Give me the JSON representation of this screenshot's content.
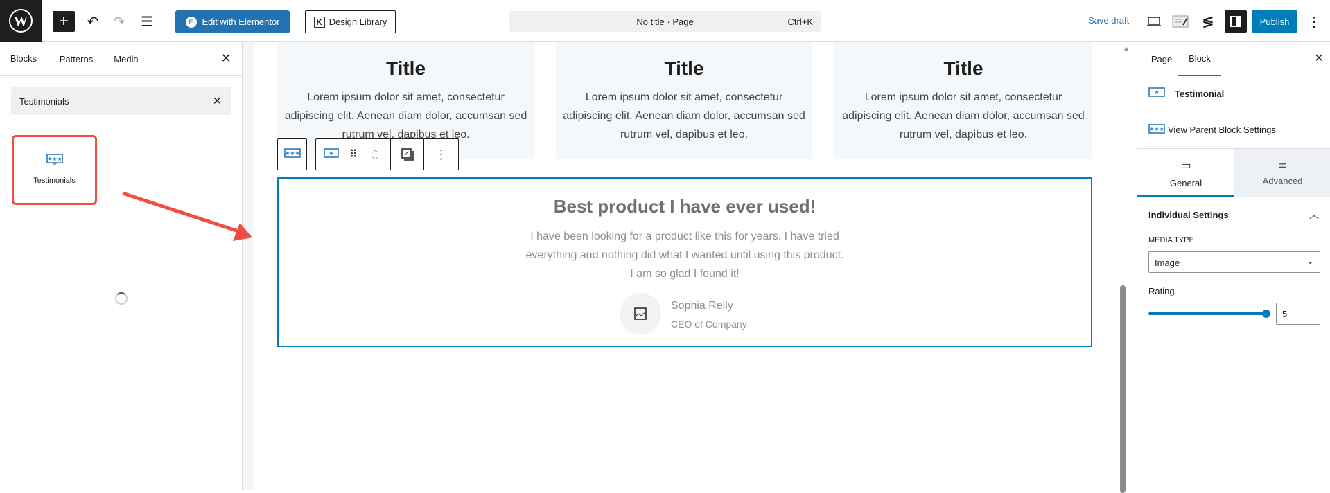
{
  "topbar": {
    "edit_elementor": "Edit with Elementor",
    "design_library": "Design Library",
    "command_title": "No title · Page",
    "command_shortcut": "Ctrl+K",
    "save_draft": "Save draft",
    "publish": "Publish"
  },
  "left_panel": {
    "tabs": [
      "Blocks",
      "Patterns",
      "Media"
    ],
    "search_value": "Testimonials",
    "result_label": "Testimonials"
  },
  "canvas": {
    "cards": [
      {
        "title": "Title",
        "text": "Lorem ipsum dolor sit amet, consectetur adipiscing elit. Aenean diam dolor, accumsan sed rutrum vel, dapibus et leo."
      },
      {
        "title": "Title",
        "text": "Lorem ipsum dolor sit amet, consectetur adipiscing elit. Aenean diam dolor, accumsan sed rutrum vel, dapibus et leo."
      },
      {
        "title": "Title",
        "text": "Lorem ipsum dolor sit amet, consectetur adipiscing elit. Aenean diam dolor, accumsan sed rutrum vel, dapibus et leo."
      }
    ],
    "testimonial": {
      "heading": "Best product I have ever used!",
      "body": "I have been looking for a product like this for years. I have tried everything and nothing did what I wanted until using this product. I am so glad I found it!",
      "name": "Sophia Reily",
      "role": "CEO of Company"
    }
  },
  "right_panel": {
    "tabs": [
      "Page",
      "Block"
    ],
    "block_name": "Testimonial",
    "parent_link": "View Parent Block Settings",
    "subtabs": [
      "General",
      "Advanced"
    ],
    "section": "Individual Settings",
    "media_type_label": "MEDIA TYPE",
    "media_type_value": "Image",
    "rating_label": "Rating",
    "rating_value": "5",
    "rating_max": 5
  },
  "colors": {
    "accent": "#007cba",
    "annotation": "#f04e45"
  }
}
